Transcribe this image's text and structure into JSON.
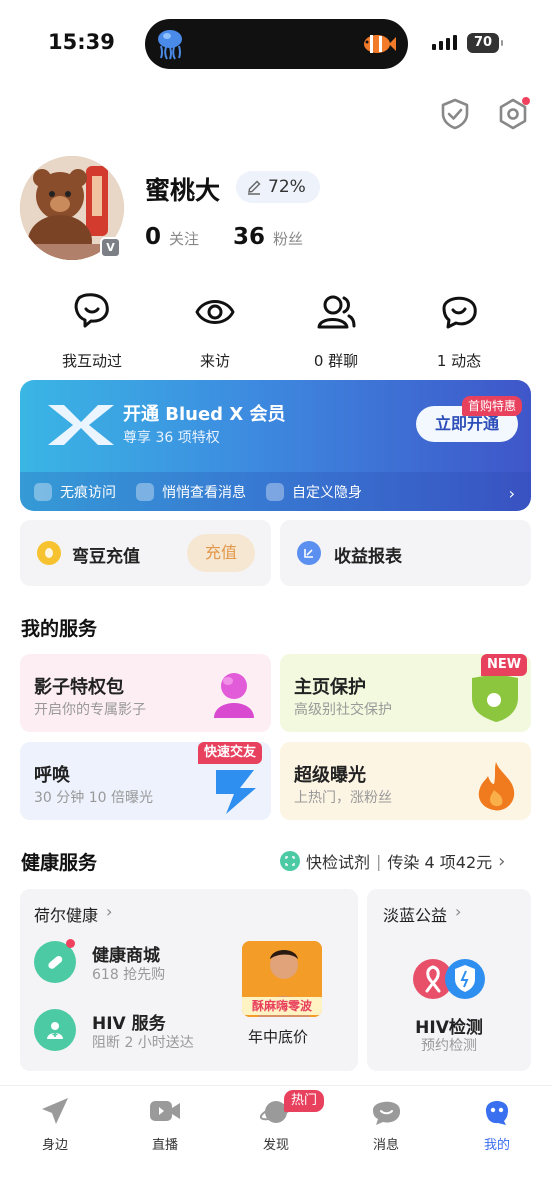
{
  "status_bar": {
    "time": "15:39",
    "battery": "70"
  },
  "profile": {
    "name": "蜜桃大",
    "completion": "72%",
    "following_count": "0",
    "following_label": "关注",
    "followers_count": "36",
    "followers_label": "粉丝",
    "badge": "V"
  },
  "quick_actions": [
    {
      "label": "我互动过",
      "icon": "interaction-icon"
    },
    {
      "label": "来访",
      "icon": "eye-icon"
    },
    {
      "label": "0 群聊",
      "icon": "group-chat-icon"
    },
    {
      "label": "1 动态",
      "icon": "moments-icon"
    }
  ],
  "vip": {
    "title": "开通 Blued X 会员",
    "subtitle": "尊享 36 项特权",
    "button": "立即开通",
    "promo_tag": "首购特惠",
    "features": [
      "无痕访问",
      "悄悄查看消息",
      "自定义隐身"
    ]
  },
  "wallet": {
    "beans_label": "弯豆充值",
    "charge_button": "充值",
    "earnings_label": "收益报表"
  },
  "my_services": {
    "title": "我的服务",
    "items": [
      {
        "title": "影子特权包",
        "subtitle": "开启你的专属影子",
        "tag": ""
      },
      {
        "title": "主页保护",
        "subtitle": "高级别社交保护",
        "tag": "NEW"
      },
      {
        "title": "呼唤",
        "subtitle": "30 分钟 10 倍曝光",
        "tag": "快速交友"
      },
      {
        "title": "超级曝光",
        "subtitle": "上热门，涨粉丝",
        "tag": ""
      }
    ]
  },
  "health": {
    "title": "健康服务",
    "promo_link": "快检试剂",
    "promo_detail": "传染 4 项42元",
    "hoer": {
      "title": "荷尔健康",
      "items": [
        {
          "title": "健康商城",
          "subtitle": "618 抢先购"
        },
        {
          "title": "HIV 服务",
          "subtitle": "阻断 2 小时送达"
        }
      ],
      "product_badge": "酥麻嗨零波",
      "product_label": "年中底价"
    },
    "danlan": {
      "title": "淡蓝公益",
      "item_title": "HIV检测",
      "item_subtitle": "预约检测"
    }
  },
  "tab_bar": {
    "tabs": [
      "身边",
      "直播",
      "发现",
      "消息",
      "我的"
    ],
    "hot_badge": "热门",
    "active": "我的"
  },
  "colors": {
    "accent": "#3a6ff0",
    "red": "#e8415e",
    "teal": "#4ccaa3"
  }
}
